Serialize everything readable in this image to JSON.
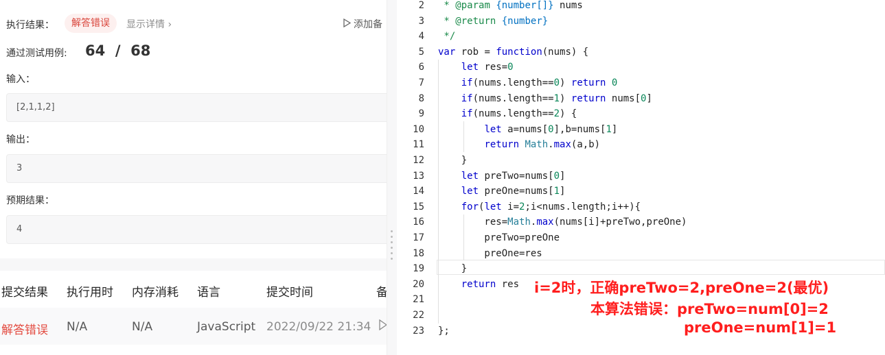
{
  "result": {
    "exec_label": "执行结果：",
    "status_badge": "解答错误",
    "details_link": "显示详情 ›",
    "add_note": "添加备",
    "passed_label": "通过测试用例:",
    "passed_count": "64  /  68",
    "input_label": "输入：",
    "input_value": "[2,1,1,2]",
    "output_label": "输出：",
    "output_value": "3",
    "expected_label": "预期结果：",
    "expected_value": "4"
  },
  "submissions": {
    "headers": [
      "提交结果",
      "执行用时",
      "内存消耗",
      "语言",
      "提交时间",
      "备"
    ],
    "row": {
      "result": "解答错误",
      "time": "N/A",
      "memory": "N/A",
      "language": "JavaScript",
      "submitted": "2022/09/22 21:34"
    }
  },
  "editor": {
    "lines": [
      {
        "n": "2",
        "code": " * @param {number[]} nums"
      },
      {
        "n": "3",
        "code": " * @return {number}"
      },
      {
        "n": "4",
        "code": " */"
      },
      {
        "n": "5",
        "code": "var rob = function(nums) {"
      },
      {
        "n": "6",
        "code": "    let res=0"
      },
      {
        "n": "7",
        "code": "    if(nums.length==0) return 0"
      },
      {
        "n": "8",
        "code": "    if(nums.length==1) return nums[0]"
      },
      {
        "n": "9",
        "code": "    if(nums.length==2) {"
      },
      {
        "n": "10",
        "code": "        let a=nums[0],b=nums[1]"
      },
      {
        "n": "11",
        "code": "        return Math.max(a,b)"
      },
      {
        "n": "12",
        "code": "    }"
      },
      {
        "n": "13",
        "code": "    let preTwo=nums[0]"
      },
      {
        "n": "14",
        "code": "    let preOne=nums[1]"
      },
      {
        "n": "15",
        "code": "    for(let i=2;i<nums.length;i++){"
      },
      {
        "n": "16",
        "code": "        res=Math.max(nums[i]+preTwo,preOne)"
      },
      {
        "n": "17",
        "code": "        preTwo=preOne"
      },
      {
        "n": "18",
        "code": "        preOne=res"
      },
      {
        "n": "19",
        "code": "    }"
      },
      {
        "n": "20",
        "code": "    return res"
      },
      {
        "n": "21",
        "code": ""
      },
      {
        "n": "22",
        "code": ""
      },
      {
        "n": "23",
        "code": "};"
      }
    ],
    "annotation": {
      "line1": "i=2时，正确preTwo=2,preOne=2(最优)",
      "line2": "本算法错误：preTwo=num[0]=2",
      "line3": "preOne=num[1]=1"
    }
  },
  "colors": {
    "error": "#e34b40",
    "annotation": "#ff1e1e",
    "keyword": "#0000cc"
  }
}
